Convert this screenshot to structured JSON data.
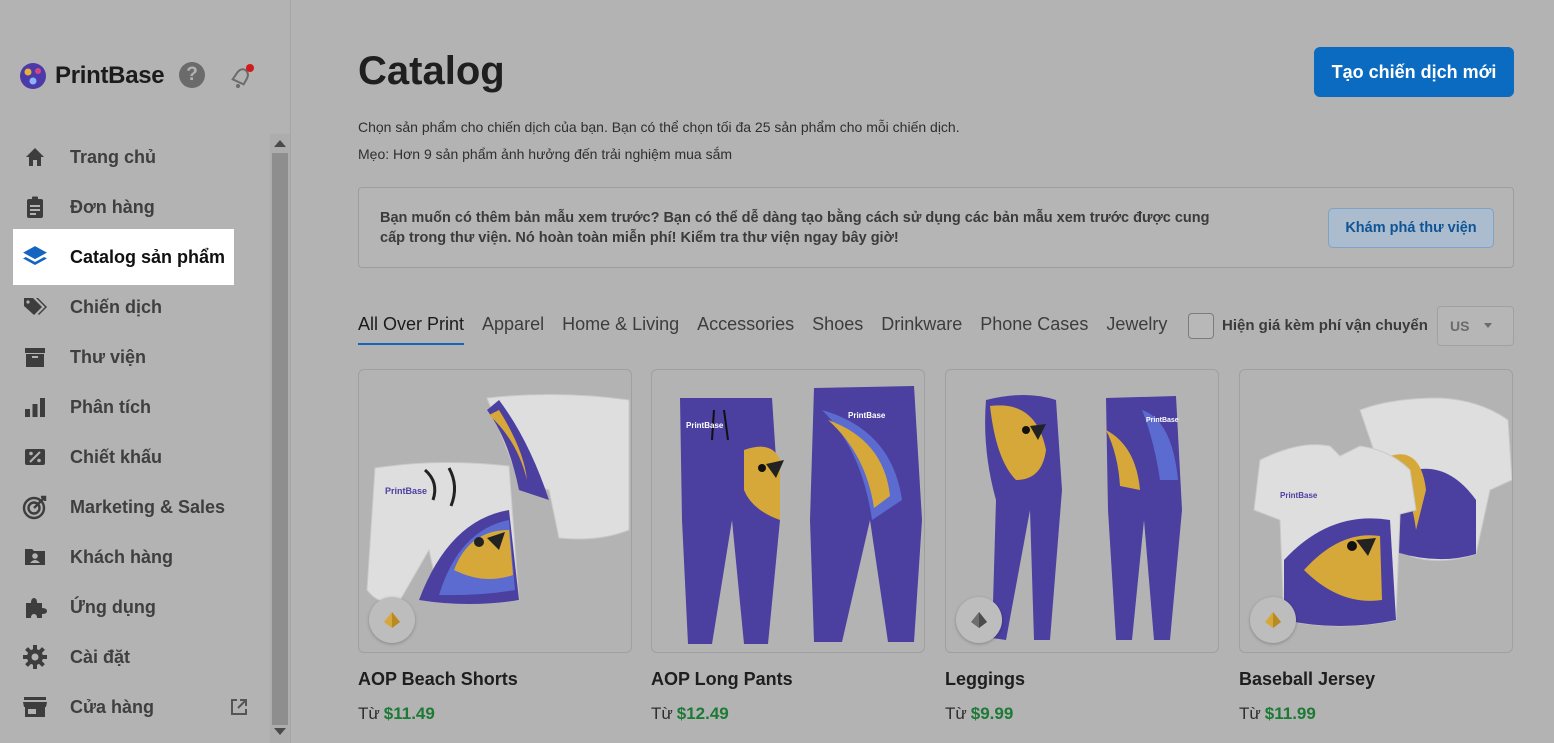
{
  "brand": {
    "name": "PrintBase"
  },
  "sidebar": {
    "items": [
      {
        "label": "Trang chủ",
        "icon": "home-icon"
      },
      {
        "label": "Đơn hàng",
        "icon": "clipboard-icon"
      },
      {
        "label": "Catalog sản phẩm",
        "icon": "layers-icon",
        "active": true
      },
      {
        "label": "Chiến dịch",
        "icon": "tag-icon"
      },
      {
        "label": "Thư viện",
        "icon": "archive-icon"
      },
      {
        "label": "Phân tích",
        "icon": "bar-chart-icon"
      },
      {
        "label": "Chiết khấu",
        "icon": "discount-icon"
      },
      {
        "label": "Marketing & Sales",
        "icon": "target-icon"
      },
      {
        "label": "Khách hàng",
        "icon": "customer-icon"
      },
      {
        "label": "Ứng dụng",
        "icon": "puzzle-icon"
      },
      {
        "label": "Cài đặt",
        "icon": "gear-icon"
      },
      {
        "label": "Cửa hàng",
        "icon": "store-icon"
      }
    ]
  },
  "header": {
    "title": "Catalog",
    "create_button": "Tạo chiến dịch mới",
    "description": "Chọn sản phẩm cho chiến dịch của bạn. Bạn có thể chọn tối đa 25 sản phẩm cho mỗi chiến dịch.",
    "tip": "Mẹo: Hơn 9 sản phẩm ảnh hưởng đến trải nghiệm mua sắm"
  },
  "promo": {
    "text": "Bạn muốn có thêm bản mẫu xem trước? Bạn có thể dễ dàng tạo bằng cách sử dụng các bản mẫu xem trước được cung cấp trong thư viện. Nó hoàn toàn miễn phí! Kiểm tra thư viện ngay bây giờ!",
    "button": "Khám phá thư viện"
  },
  "tabs": [
    "All Over Print",
    "Apparel",
    "Home & Living",
    "Accessories",
    "Shoes",
    "Drinkware",
    "Phone Cases",
    "Jewelry"
  ],
  "shipping": {
    "label": "Hiện giá kèm phí vận chuyển",
    "checked": false,
    "country": "US"
  },
  "products": [
    {
      "name": "AOP Beach Shorts",
      "price_prefix": "Từ",
      "price": "$11.49",
      "badge": "gold"
    },
    {
      "name": "AOP Long Pants",
      "price_prefix": "Từ",
      "price": "$12.49",
      "badge": "none"
    },
    {
      "name": "Leggings",
      "price_prefix": "Từ",
      "price": "$9.99",
      "badge": "gray"
    },
    {
      "name": "Baseball Jersey",
      "price_prefix": "Từ",
      "price": "$11.99",
      "badge": "gold"
    }
  ],
  "colors": {
    "accent": "#0b6bc1",
    "price": "#1c7a34",
    "product_purple": "#4b3fa0",
    "parrot_gold": "#d6a83a"
  }
}
